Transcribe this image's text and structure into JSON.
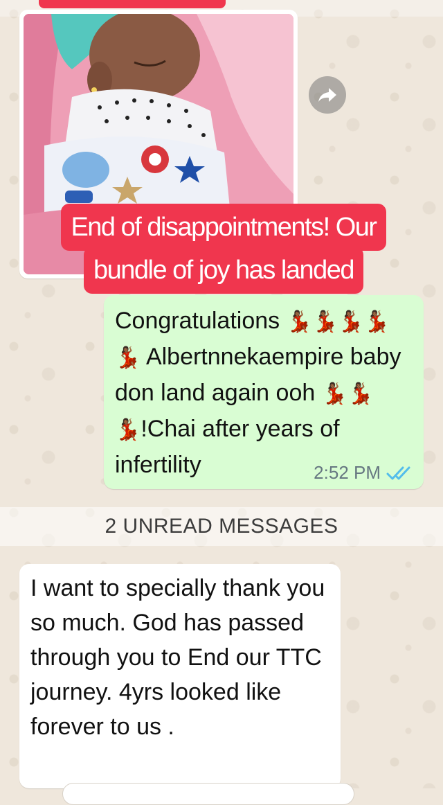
{
  "caption": {
    "line1": "End of disappointments! Our",
    "line2": "bundle of joy has landed"
  },
  "outgoing_message": {
    "part1": "Congratulations",
    "part2": "Albertnnekaempire baby don land again ooh",
    "part3": "!Chai after years of infertility",
    "time": "2:52 PM",
    "status": "read"
  },
  "divider": {
    "label": "2 UNREAD MESSAGES"
  },
  "incoming_message": {
    "text": "I want to specially thank you so much. God has passed through you to End our TTC journey. 4yrs looked like forever to us ."
  },
  "icons": {
    "forward": "forward-icon",
    "read_receipt": "double-check-icon",
    "emoji": "dancing-woman-emoji"
  },
  "colors": {
    "caption_bg": "#f0364e",
    "outgoing_bg": "#d9fdd3",
    "incoming_bg": "#ffffff",
    "read_tick": "#53bdeb",
    "wallpaper": "#efe7dc"
  }
}
